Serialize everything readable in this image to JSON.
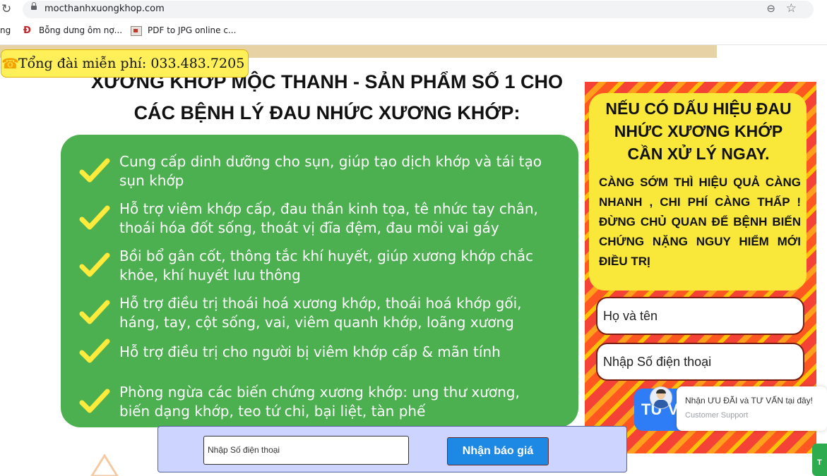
{
  "browser": {
    "url": "mocthanhxuongkhop.com",
    "reload_icon": "reload-icon",
    "bookmarks": [
      {
        "label": "ng"
      },
      {
        "label": "Bỗng dưng ôm nợ..."
      },
      {
        "label": "PDF to JPG online c..."
      }
    ]
  },
  "hotline": {
    "text": "Tổng đài miễn phí: 033.483.7205"
  },
  "headline": {
    "line1": "XƯƠNG KHỚP MỘC THANH - SẢN PHẨM SỐ 1 CHO",
    "line2": "CÁC BỆNH LÝ ĐAU NHỨC XƯƠNG KHỚP:"
  },
  "benefits": [
    {
      "text": "Cung cấp dinh dưỡng cho sụn, giúp tạo dịch khớp và tái tạo sụn khớp"
    },
    {
      "text": "Hỗ trợ viêm khớp cấp, đau thần kinh tọa, tê nhức tay chân, thoái hóa đốt sống, thoát vị đĩa đệm, đau mỏi vai gáy"
    },
    {
      "text": "Bồi bổ gân cốt, thông tắc khí huyết, giúp xương khớp chắc khỏe, khí huyết lưu thông"
    },
    {
      "text": "Hỗ trợ điều trị thoái hoá xương khớp, thoái hoá khớp gối, háng, tay, cột sống, vai, viêm quanh khớp, loãng xương"
    },
    {
      "text": "Hỗ trợ điều trị cho người bị viêm khớp cấp & mãn tính"
    },
    {
      "text": "Phòng ngừa các biến chứng xương khớp: ung thư xương, biến dạng khớp, teo tứ chi, bại liệt, tàn phế"
    }
  ],
  "promo": {
    "title": "NẾU CÓ DẤU HIỆU ĐAU NHỨC XƯƠNG KHỚP CẦN XỬ LÝ NGAY.",
    "subtitle": "CÀNG SỚM THÌ HIỆU QUẢ CÀNG NHANH , CHI PHÍ CÀNG THẤP ! ĐỪNG CHỦ QUAN ĐỂ BỆNH BIẾN CHỨNG NẶNG NGUY HIỂM MỚI ĐIỀU TRỊ",
    "name_placeholder": "Họ và tên",
    "phone_placeholder": "Nhập Số điện thoại",
    "submit_label": "TƯ V"
  },
  "chat": {
    "message": "Nhận ƯU ĐÃI và TƯ VẤN tại đây!",
    "subtitle": "Customer Support"
  },
  "green_tab": {
    "label": "T"
  },
  "quote_bar": {
    "phone_placeholder": "Nhập Số điện thoại",
    "button_label": "Nhận báo giá"
  },
  "colors": {
    "benefit_bg": "#4caf50",
    "promo_card": "#f9e83a",
    "hotline_bg": "#fff05a",
    "quote_button": "#1e88e5",
    "quote_bar_bg": "#cdd4ff",
    "tuvan_button": "#2e7cf6"
  }
}
